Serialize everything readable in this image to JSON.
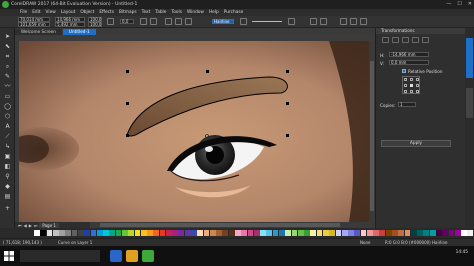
{
  "window": {
    "title": "CorelDRAW 2017 (64-Bit Evaluation Version) - Untitled-1",
    "controls": [
      "—",
      "☐",
      "✕"
    ]
  },
  "menubar": [
    "File",
    "Edit",
    "View",
    "Layout",
    "Object",
    "Effects",
    "Bitmaps",
    "Text",
    "Table",
    "Tools",
    "Window",
    "Help",
    "Purchase"
  ],
  "toolbar": {
    "x_value": "70,014 mm",
    "y_value": "101,659 mm",
    "width_value": "14,966 mm",
    "height_value": "5,492 mm",
    "scale_x": "100,0",
    "scale_y": "100,0",
    "angle": "0,0",
    "outline_width": "Hairline"
  },
  "tabs": [
    "Welcome Screen",
    "Untitled-1"
  ],
  "page_nav": {
    "page_label": "Page 1"
  },
  "docker": {
    "title": "Transformations",
    "h_label": "H:",
    "h_value": "-14,966 mm",
    "v_label": "V:",
    "v_value": "0,0 mm",
    "relative_position": "Relative Position",
    "copies_label": "Copies:",
    "copies_value": "1",
    "apply_label": "Apply",
    "side_tabs": [
      "Transformations",
      "Properties"
    ]
  },
  "palette": {
    "colors": [
      "#ffffff",
      "#000000",
      "#e0e0e0",
      "#c0c0c0",
      "#a0a0a0",
      "#808080",
      "#606060",
      "#404040",
      "#1d3fa8",
      "#2f6fd6",
      "#00a0e0",
      "#00c8d8",
      "#00a88a",
      "#1fa84a",
      "#6ac23a",
      "#b8d82a",
      "#f0e020",
      "#f8c020",
      "#f89820",
      "#f06820",
      "#e83a22",
      "#c82050",
      "#a8207a",
      "#7a2aa0",
      "#5a3aa8",
      "#3a4aa8",
      "#ffd8b8",
      "#e8b080",
      "#c88850",
      "#a06030",
      "#784020",
      "#583018",
      "#f4a8c8",
      "#e878a8",
      "#d04888",
      "#a83068",
      "#88e0f8",
      "#58c0e8",
      "#2898d0",
      "#1878b0",
      "#c8f0a8",
      "#98d870",
      "#68c048",
      "#38a030",
      "#f8f0a8",
      "#f0e070",
      "#e8d040",
      "#d8b820",
      "#d0d0ff",
      "#a8a8f0",
      "#8080e0",
      "#5858c8",
      "#ffc8c8",
      "#f09898",
      "#e06868",
      "#c84040",
      "#804000",
      "#a05020",
      "#c07040",
      "#e09060",
      "#004040",
      "#006060",
      "#008080",
      "#00a0a0",
      "#400040",
      "#600060",
      "#800080",
      "#a000a0",
      "#ffffff",
      "#f0f0f0"
    ]
  },
  "statusbar": {
    "left_text": "( 71,618; 190,143 )",
    "mid_text": "Curve on Layer 1",
    "fill_text": "None",
    "outline_text": "R:0 G:0 B:0 (#000000)  Hairline"
  },
  "taskbar": {
    "search_placeholder": "",
    "time": "14:45",
    "date": ""
  }
}
